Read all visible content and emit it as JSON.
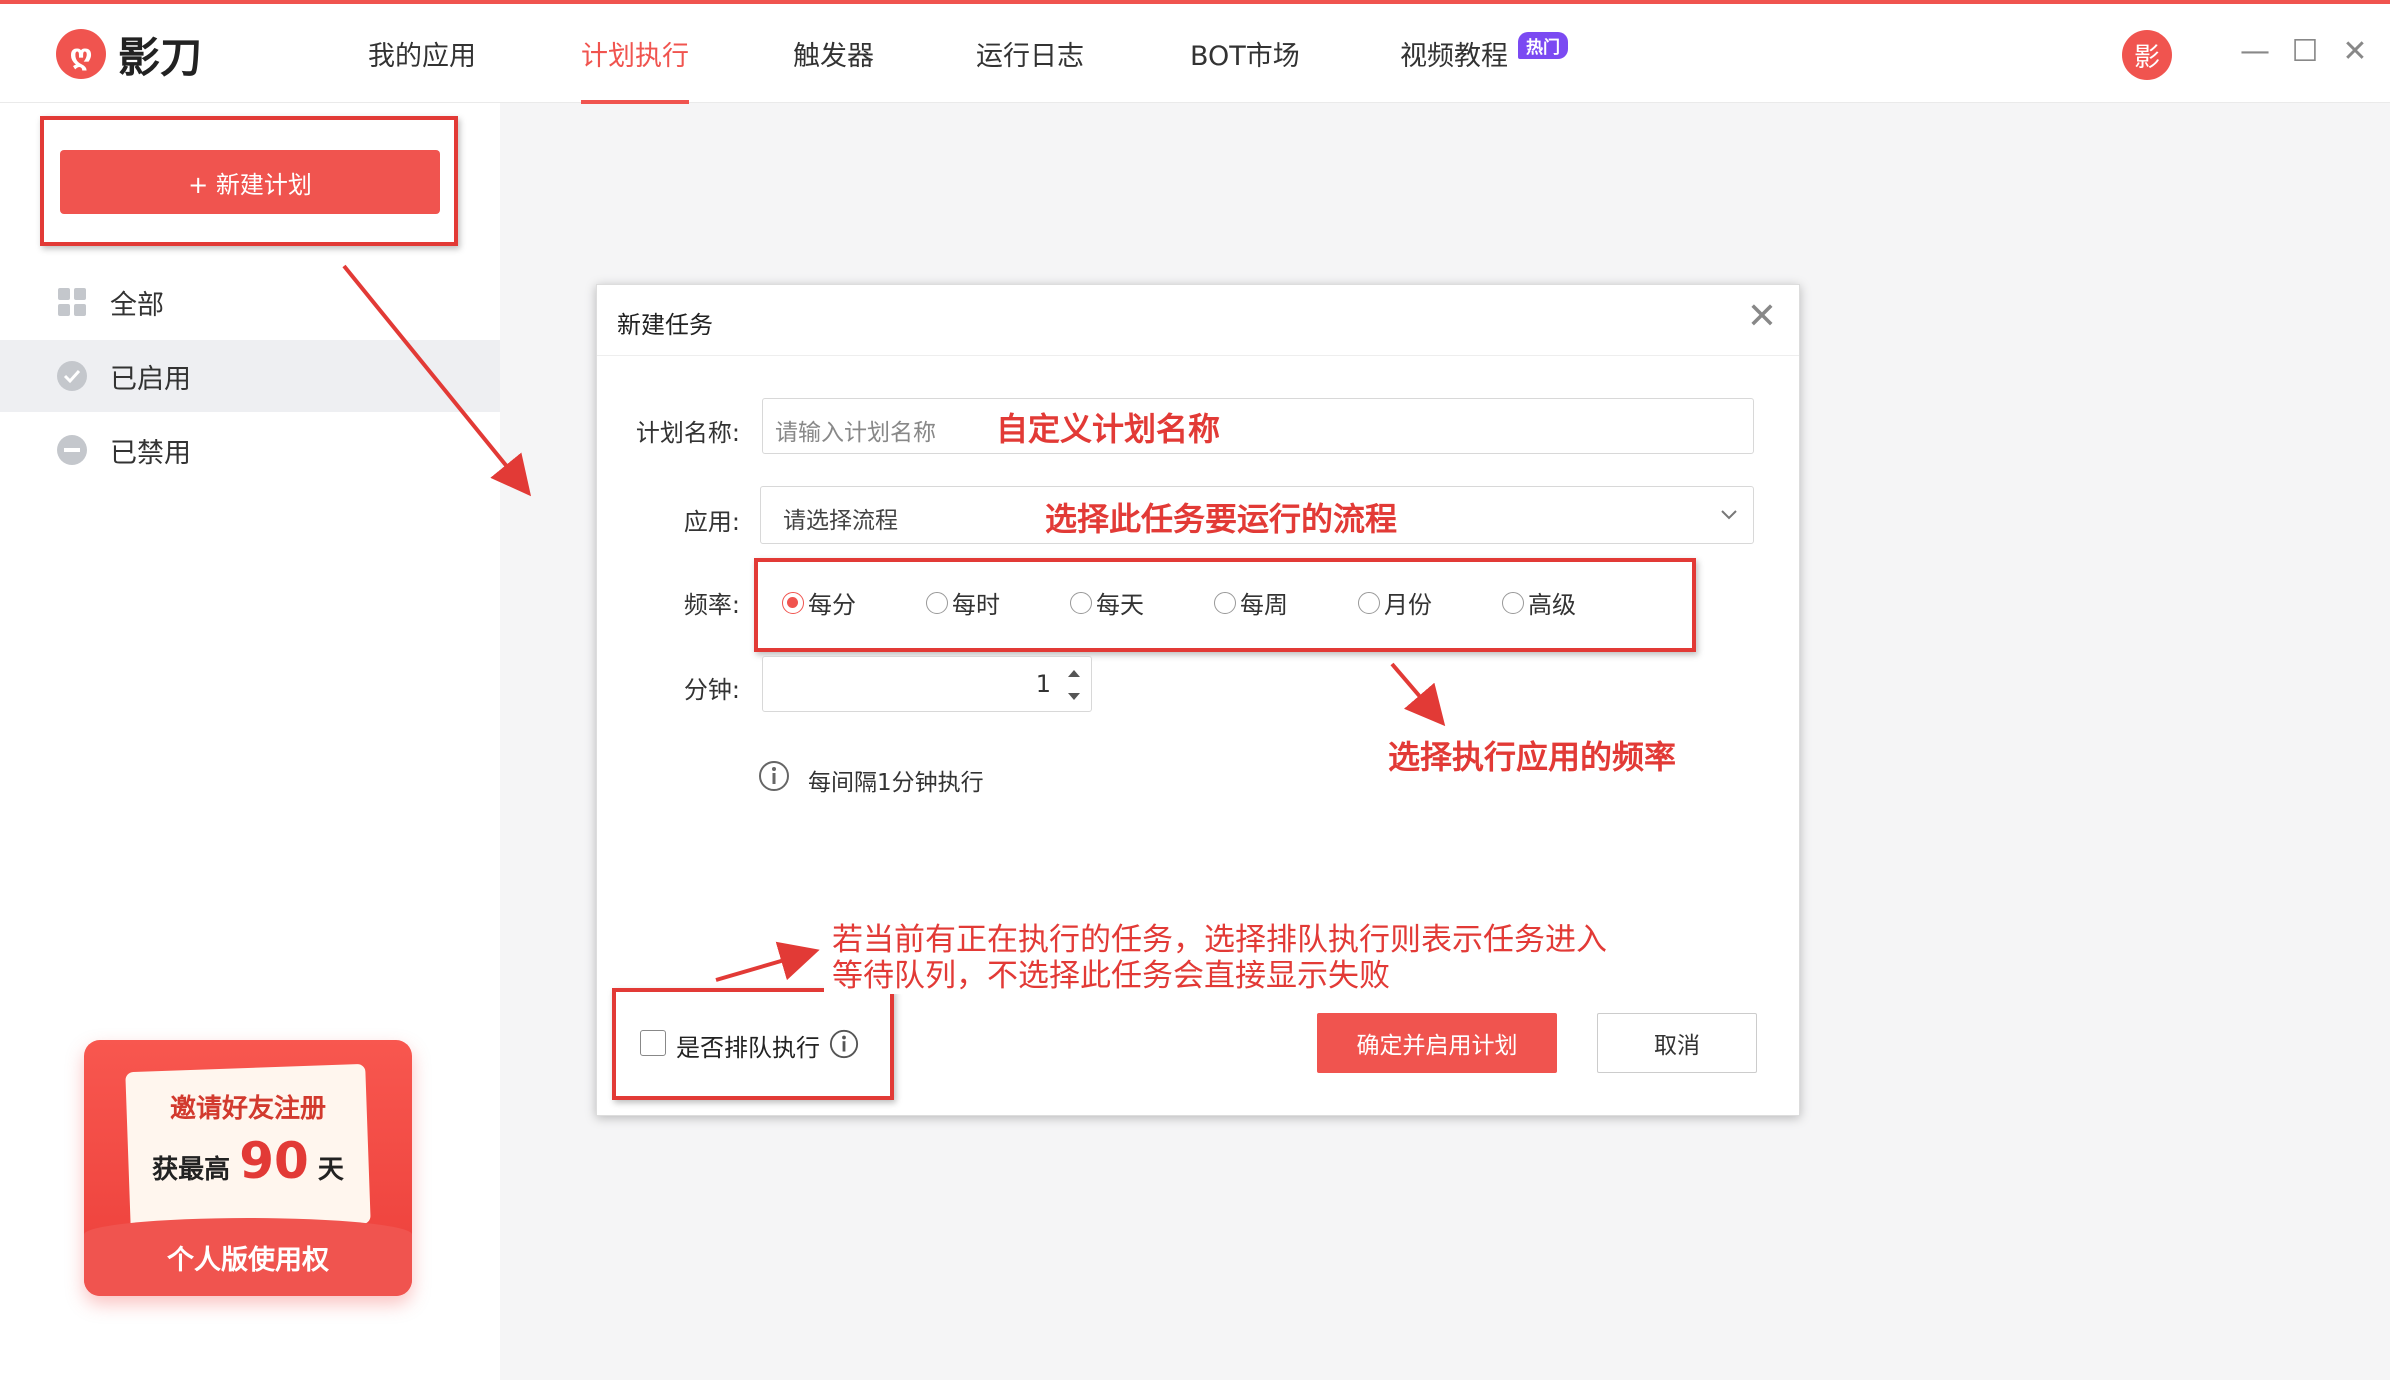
{
  "app": {
    "name": "影刀",
    "logo_glyph": "ღ",
    "avatar_text": "影"
  },
  "nav": {
    "items": [
      "我的应用",
      "计划执行",
      "触发器",
      "运行日志",
      "BOT市场",
      "视频教程"
    ],
    "active": "计划执行",
    "badge": "热门"
  },
  "window_controls": {
    "minimize": "—",
    "maximize": "☐",
    "close": "✕"
  },
  "sidebar": {
    "new_button": "+ 新建计划",
    "items": [
      {
        "label": "全部",
        "icon": "grid-icon"
      },
      {
        "label": "已启用",
        "icon": "check-circle-icon"
      },
      {
        "label": "已禁用",
        "icon": "minus-circle-icon"
      }
    ],
    "active": "已启用"
  },
  "promo": {
    "line1": "邀请好友注册",
    "line2_prefix": "获最高",
    "line2_number": "90",
    "line2_suffix": "天",
    "footer": "个人版使用权"
  },
  "dialog": {
    "title": "新建任务",
    "close": "✕",
    "name_label": "计划名称:",
    "name_placeholder": "请输入计划名称",
    "app_label": "应用:",
    "app_placeholder": "请选择流程",
    "frequency_label": "频率:",
    "frequency_options": [
      "每分",
      "每时",
      "每天",
      "每周",
      "月份",
      "高级"
    ],
    "frequency_selected": "每分",
    "minute_label": "分钟:",
    "minute_value": "1",
    "info_text": "每间隔1分钟执行",
    "queue_label": "是否排队执行",
    "queue_checked": false,
    "confirm_button": "确定并启用计划",
    "cancel_button": "取消"
  },
  "annotations": {
    "name_note": "自定义计划名称",
    "app_note": "选择此任务要运行的流程",
    "frequency_note": "选择执行应用的频率",
    "queue_note_line1": "若当前有正在执行的任务，选择排队执行则表示任务进入",
    "queue_note_line2": "等待队列，不选择此任务会直接显示失败"
  },
  "colors": {
    "accent": "#f0544f",
    "annotation": "#e23a36",
    "badge": "#7b4af2"
  }
}
